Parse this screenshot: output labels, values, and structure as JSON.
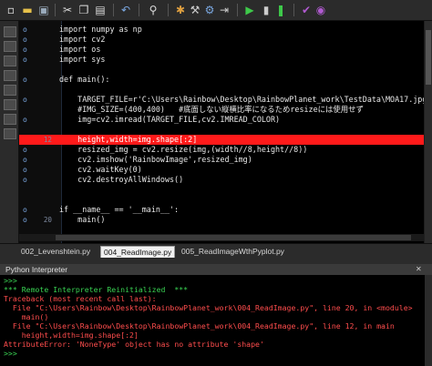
{
  "toolbar": {
    "icons": [
      "new-file-icon",
      "open-folder-icon",
      "save-icon",
      "cut-icon",
      "copy-icon",
      "paste-icon",
      "undo-icon",
      "search-icon",
      "bug-icon",
      "tools-icon",
      "debug-icon",
      "step-icon",
      "run-icon",
      "stop-icon",
      "prev-icon",
      "next-icon"
    ]
  },
  "editor": {
    "lines": [
      {
        "num": "",
        "mark": "o",
        "text": "import numpy as np"
      },
      {
        "num": "",
        "mark": "o",
        "text": "import cv2"
      },
      {
        "num": "",
        "mark": "o",
        "text": "import os"
      },
      {
        "num": "",
        "mark": "o",
        "text": "import sys"
      },
      {
        "num": "",
        "mark": "",
        "text": ""
      },
      {
        "num": "",
        "mark": "o",
        "text": "def main():"
      },
      {
        "num": "",
        "mark": "",
        "text": ""
      },
      {
        "num": "",
        "mark": "o",
        "text": "    TARGET_FILE=r'C:\\Users\\Rainbow\\Desktop\\RainbowPlanet_work\\TestData\\MOA17.jpg'"
      },
      {
        "num": "",
        "mark": "",
        "text": "    #IMG_SIZE=(400,400)   #底面しない縦横比率になるためresizeには使用せず"
      },
      {
        "num": "",
        "mark": "o",
        "text": "    img=cv2.imread(TARGET_FILE,cv2.IMREAD_COLOR)"
      },
      {
        "num": "",
        "mark": "",
        "text": ""
      },
      {
        "num": "12",
        "mark": "",
        "text": "    height,width=img.shape[:2]",
        "highlight": true
      },
      {
        "num": "",
        "mark": "o",
        "text": "    resized_img = cv2.resize(img,(width//8,height//8))"
      },
      {
        "num": "",
        "mark": "o",
        "text": "    cv2.imshow('RainbowImage',resized_img)"
      },
      {
        "num": "",
        "mark": "o",
        "text": "    cv2.waitKey(0)"
      },
      {
        "num": "",
        "mark": "o",
        "text": "    cv2.destroyAllWindows()"
      },
      {
        "num": "",
        "mark": "",
        "text": ""
      },
      {
        "num": "",
        "mark": "",
        "text": ""
      },
      {
        "num": "",
        "mark": "o",
        "text": "if __name__ == '__main__':"
      },
      {
        "num": "20",
        "mark": "o",
        "text": "    main()"
      }
    ]
  },
  "tabs": [
    {
      "label": "002_Levenshtein.py",
      "active": false
    },
    {
      "label": "004_ReadImage.py",
      "active": true
    },
    {
      "label": "005_ReadImageWthPyplot.py",
      "active": false
    }
  ],
  "panel": {
    "title": "Python Interpreter"
  },
  "console": {
    "lines": [
      {
        "text": ">>>",
        "color": "green"
      },
      {
        "text": "*** Remote Interpreter Reinitialized  ***",
        "color": "green"
      },
      {
        "text": "Traceback (most recent call last):",
        "color": "red"
      },
      {
        "text": "  File \"C:\\Users\\Rainbow\\Desktop\\RainbowPlanet_work\\004_ReadImage.py\", line 20, in <module>",
        "color": "red"
      },
      {
        "text": "    main()",
        "color": "red"
      },
      {
        "text": "  File \"C:\\Users\\Rainbow\\Desktop\\RainbowPlanet_work\\004_ReadImage.py\", line 12, in main",
        "color": "red"
      },
      {
        "text": "    height,width=img.shape[:2]",
        "color": "red"
      },
      {
        "text": "AttributeError: 'NoneType' object has no attribute 'shape'",
        "color": "red"
      },
      {
        "text": ">>>",
        "color": "green"
      }
    ]
  }
}
